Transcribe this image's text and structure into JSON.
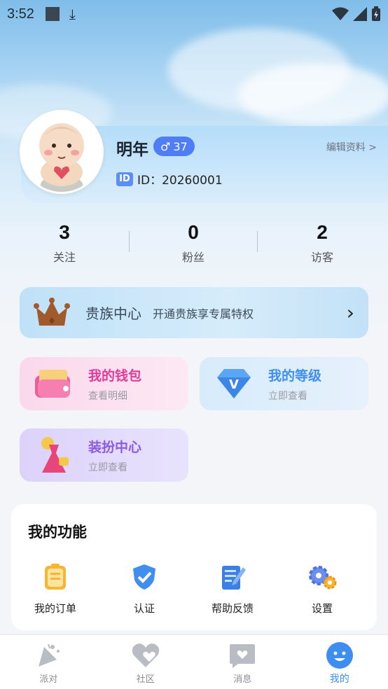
{
  "status_bar": {
    "time": "3:52"
  },
  "profile": {
    "name": "明年",
    "gender_symbol": "♂",
    "level": "37",
    "edit_label": "编辑资料 >",
    "id_icon": "ID",
    "id_text": "ID：20260001"
  },
  "stats": [
    {
      "value": "3",
      "label": "关注"
    },
    {
      "value": "0",
      "label": "粉丝"
    },
    {
      "value": "2",
      "label": "访客"
    }
  ],
  "noble": {
    "title": "贵族中心",
    "subtitle": "开通贵族享专属特权",
    "arrow": "›"
  },
  "tiles": {
    "wallet": {
      "title": "我的钱包",
      "subtitle": "查看明细",
      "title_color": "#e23a9a"
    },
    "level": {
      "title": "我的等级",
      "subtitle": "立即查看",
      "title_color": "#3d8ff0"
    },
    "dressup": {
      "title": "装扮中心",
      "subtitle": "立即查看",
      "title_color": "#8a5ae8"
    }
  },
  "features": {
    "title": "我的功能",
    "items": [
      {
        "label": "我的订单",
        "icon": "order-icon"
      },
      {
        "label": "认证",
        "icon": "shield-check-icon"
      },
      {
        "label": "帮助反馈",
        "icon": "feedback-icon"
      },
      {
        "label": "设置",
        "icon": "gear-icon"
      }
    ]
  },
  "tabbar": {
    "items": [
      {
        "label": "派对",
        "icon": "party-icon"
      },
      {
        "label": "社区",
        "icon": "heart-icon"
      },
      {
        "label": "消息",
        "icon": "message-icon"
      },
      {
        "label": "我的",
        "icon": "smile-icon",
        "active": true
      }
    ],
    "active_color": "#3e8ef2"
  }
}
